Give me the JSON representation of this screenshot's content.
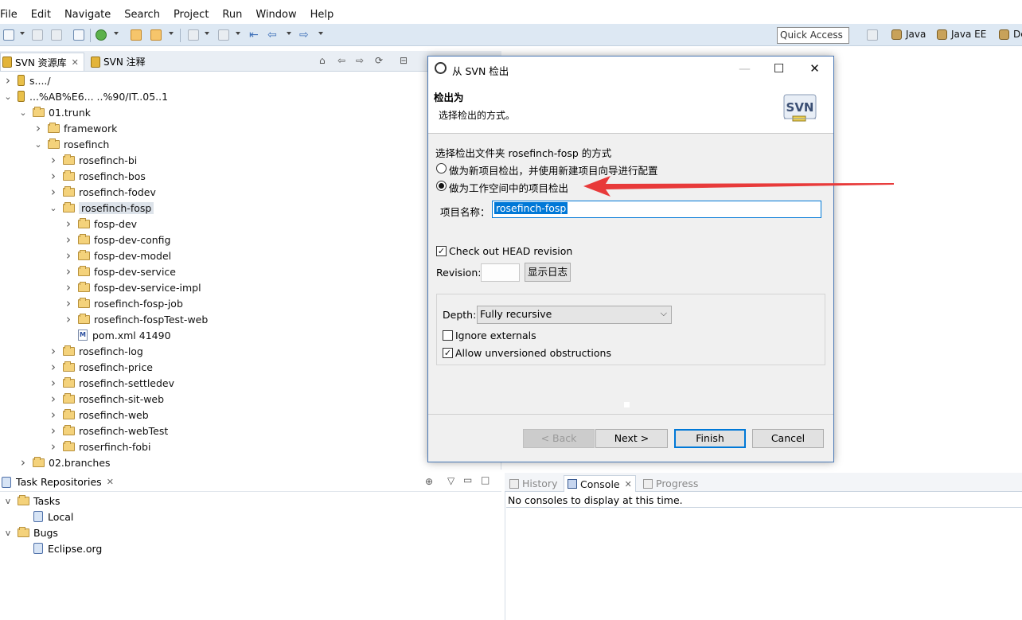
{
  "menu": [
    "File",
    "Edit",
    "Navigate",
    "Search",
    "Project",
    "Run",
    "Window",
    "Help"
  ],
  "toolbar": {
    "quick_access": "Quick Access",
    "perspectives": [
      "Java",
      "Java EE",
      "De"
    ]
  },
  "top_tabs": [
    {
      "label": "SVN 资源库",
      "active": true
    },
    {
      "label": "SVN 注释",
      "active": false
    }
  ],
  "tree": [
    {
      "label": "s..../",
      "depth": 0,
      "icon": "repo",
      "chev": ">"
    },
    {
      "label": "...%AB%E6... ..%90/IT..05..1",
      "depth": 0,
      "icon": "repo",
      "chev": "v"
    },
    {
      "label": "01.trunk",
      "depth": 1,
      "icon": "folder",
      "chev": "v"
    },
    {
      "label": "framework",
      "depth": 2,
      "icon": "folder",
      "chev": ">"
    },
    {
      "label": "rosefinch",
      "depth": 2,
      "icon": "folder",
      "chev": "v"
    },
    {
      "label": "rosefinch-bi",
      "depth": 3,
      "icon": "folder",
      "chev": ">"
    },
    {
      "label": "rosefinch-bos",
      "depth": 3,
      "icon": "folder",
      "chev": ">"
    },
    {
      "label": "rosefinch-fodev",
      "depth": 3,
      "icon": "folder",
      "chev": ">"
    },
    {
      "label": "rosefinch-fosp",
      "depth": 3,
      "icon": "folder",
      "chev": "v",
      "selected": true
    },
    {
      "label": "fosp-dev",
      "depth": 4,
      "icon": "folder",
      "chev": ">"
    },
    {
      "label": "fosp-dev-config",
      "depth": 4,
      "icon": "folder",
      "chev": ">"
    },
    {
      "label": "fosp-dev-model",
      "depth": 4,
      "icon": "folder",
      "chev": ">"
    },
    {
      "label": "fosp-dev-service",
      "depth": 4,
      "icon": "folder",
      "chev": ">"
    },
    {
      "label": "fosp-dev-service-impl",
      "depth": 4,
      "icon": "folder",
      "chev": ">"
    },
    {
      "label": "rosefinch-fosp-job",
      "depth": 4,
      "icon": "folder",
      "chev": ">"
    },
    {
      "label": "rosefinch-fospTest-web",
      "depth": 4,
      "icon": "folder",
      "chev": ">"
    },
    {
      "label": "pom.xml 41490",
      "depth": 4,
      "icon": "file",
      "chev": ""
    },
    {
      "label": "rosefinch-log",
      "depth": 3,
      "icon": "folder",
      "chev": ">"
    },
    {
      "label": "rosefinch-price",
      "depth": 3,
      "icon": "folder",
      "chev": ">"
    },
    {
      "label": "rosefinch-settledev",
      "depth": 3,
      "icon": "folder",
      "chev": ">"
    },
    {
      "label": "rosefinch-sit-web",
      "depth": 3,
      "icon": "folder",
      "chev": ">"
    },
    {
      "label": "rosefinch-web",
      "depth": 3,
      "icon": "folder",
      "chev": ">"
    },
    {
      "label": "rosefinch-webTest",
      "depth": 3,
      "icon": "folder",
      "chev": ">"
    },
    {
      "label": "roserfinch-fobi",
      "depth": 3,
      "icon": "folder",
      "chev": ">"
    },
    {
      "label": "02.branches",
      "depth": 1,
      "icon": "folder",
      "chev": ">"
    }
  ],
  "task_repos": {
    "tab_label": "Task Repositories",
    "items": [
      {
        "label": "Tasks",
        "type": "folder",
        "chev": "v"
      },
      {
        "label": "Local",
        "type": "leaf"
      },
      {
        "label": "Bugs",
        "type": "folder",
        "chev": "v"
      },
      {
        "label": "Eclipse.org",
        "type": "leaf"
      }
    ]
  },
  "bottom_right": {
    "tabs": [
      {
        "label": "History",
        "active": false
      },
      {
        "label": "Console",
        "active": true
      },
      {
        "label": "Progress",
        "active": false
      }
    ],
    "console_text": "No consoles to display at this time."
  },
  "dialog": {
    "title": "从 SVN 检出",
    "header_title": "检出为",
    "header_desc": "选择检出的方式。",
    "section_label": "选择检出文件夹 rosefinch-fosp 的方式",
    "radio_new_project": "做为新项目检出，并使用新建项目向导进行配置",
    "radio_workspace_project": "做为工作空间中的项目检出",
    "project_name_label": "项目名称：",
    "project_name_value": "rosefinch-fosp",
    "checkout_head_label": "Check out HEAD revision",
    "revision_label": "Revision:",
    "revision_value": "",
    "show_log_button": "显示日志",
    "depth_label": "Depth:",
    "depth_value": "Fully recursive",
    "ignore_externals_label": "Ignore externals",
    "allow_unversioned_label": "Allow unversioned obstructions",
    "buttons": {
      "back": "< Back",
      "next": "Next >",
      "finish": "Finish",
      "cancel": "Cancel"
    },
    "logo_text": "SVN"
  },
  "colors": {
    "toolbar_bg": "#dde8f3",
    "selection": "#0078d7",
    "annotation_arrow": "#e83a3a"
  }
}
